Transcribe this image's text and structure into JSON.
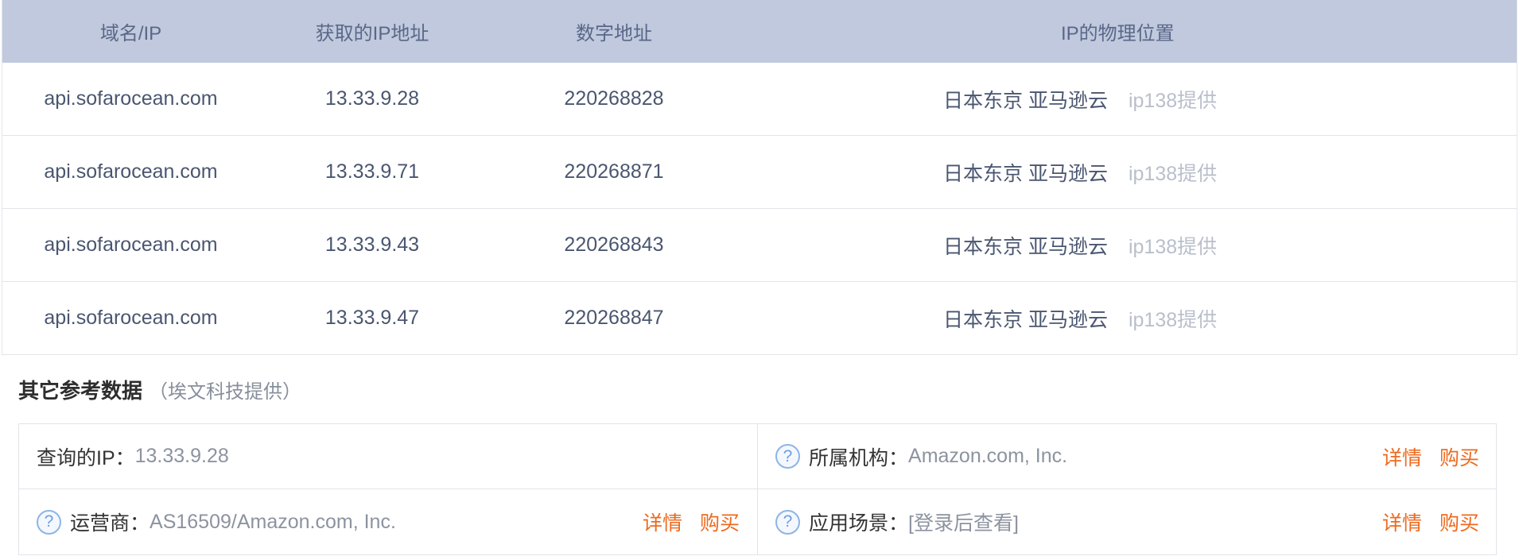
{
  "table": {
    "headers": {
      "domain": "域名/IP",
      "ip": "获取的IP地址",
      "numeric": "数字地址",
      "location": "IP的物理位置"
    },
    "rows": [
      {
        "domain": "api.sofarocean.com",
        "ip": "13.33.9.28",
        "numeric": "220268828",
        "location": "日本东京 亚马逊云",
        "provider": "ip138提供"
      },
      {
        "domain": "api.sofarocean.com",
        "ip": "13.33.9.71",
        "numeric": "220268871",
        "location": "日本东京 亚马逊云",
        "provider": "ip138提供"
      },
      {
        "domain": "api.sofarocean.com",
        "ip": "13.33.9.43",
        "numeric": "220268843",
        "location": "日本东京 亚马逊云",
        "provider": "ip138提供"
      },
      {
        "domain": "api.sofarocean.com",
        "ip": "13.33.9.47",
        "numeric": "220268847",
        "location": "日本东京 亚马逊云",
        "provider": "ip138提供"
      }
    ]
  },
  "reference": {
    "title": "其它参考数据",
    "subtitle": "（埃文科技提供）",
    "query_ip": {
      "label": "查询的IP：",
      "value": "13.33.9.28"
    },
    "org": {
      "label": "所属机构：",
      "value": "Amazon.com, Inc.",
      "detail": "详情",
      "buy": "购买"
    },
    "isp": {
      "label": "运营商：",
      "value": "AS16509/Amazon.com, Inc.",
      "detail": "详情",
      "buy": "购买"
    },
    "scene": {
      "label": "应用场景：",
      "value": "[登录后查看]",
      "detail": "详情",
      "buy": "购买"
    },
    "help_icon": "?"
  },
  "colors": {
    "header_bg": "#c0c9dd",
    "link_accent": "#ee6a1e",
    "help_icon": "#8db5e6"
  }
}
